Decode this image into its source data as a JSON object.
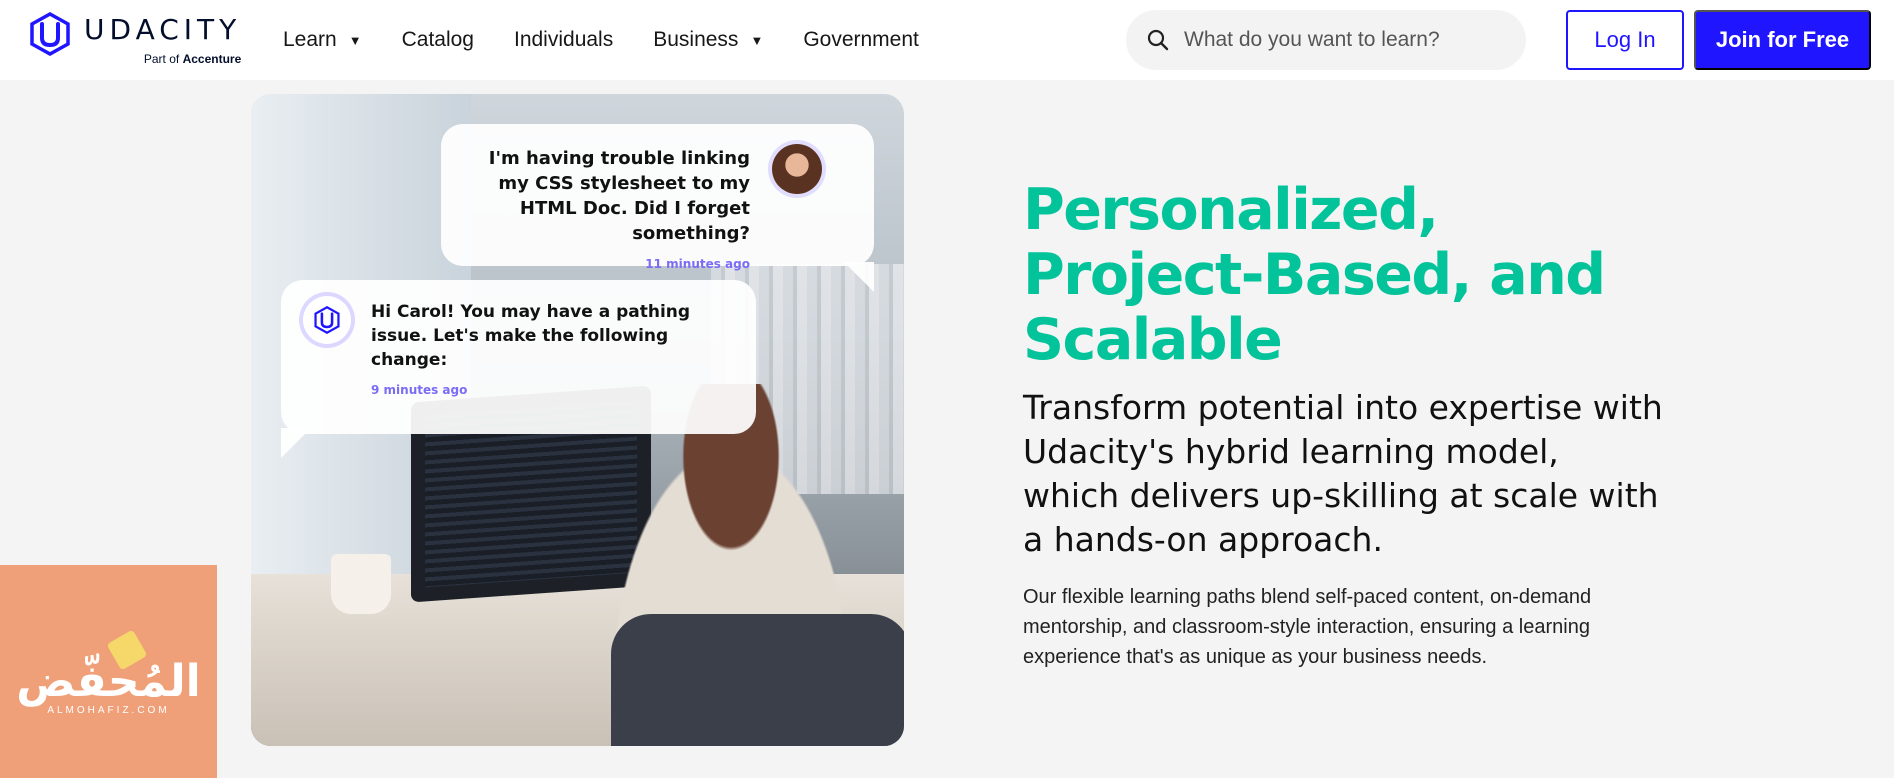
{
  "brand": {
    "name": "UDACITY",
    "tagline_prefix": "Part of",
    "tagline_company": "Accenture",
    "accent_color": "#2015ff"
  },
  "nav": {
    "items": [
      {
        "label": "Learn",
        "has_dropdown": true
      },
      {
        "label": "Catalog",
        "has_dropdown": false
      },
      {
        "label": "Individuals",
        "has_dropdown": false
      },
      {
        "label": "Business",
        "has_dropdown": true
      },
      {
        "label": "Government",
        "has_dropdown": false
      }
    ],
    "dropdown_icon": "▼"
  },
  "search": {
    "placeholder": "What do you want to learn?",
    "value": "",
    "icon": "search-icon"
  },
  "auth": {
    "login_label": "Log In",
    "join_label": "Join for Free"
  },
  "hero_image": {
    "user_message": "I'm having trouble linking my CSS stylesheet to my HTML Doc. Did I forget something?",
    "user_message_time": "11 minutes ago",
    "agent_message": "Hi Carol! You may have a pathing issue. Let's make the following change:",
    "agent_message_time": "9 minutes ago"
  },
  "hero": {
    "headline": "Personalized, Project-Based, and Scalable",
    "headline_color": "#02c39a",
    "subhead": "Transform potential into expertise with Udacity's hybrid learning model, which delivers up-skilling at scale with a hands-on approach.",
    "body": "Our flexible learning paths blend self-paced content, on-demand mentorship, and classroom-style interaction, ensuring a learning experience that's as unique as your business needs."
  },
  "watermark": {
    "text": "المُحفّض",
    "subtext": "ALMOHAFIZ.COM",
    "color": "#f0a078"
  }
}
